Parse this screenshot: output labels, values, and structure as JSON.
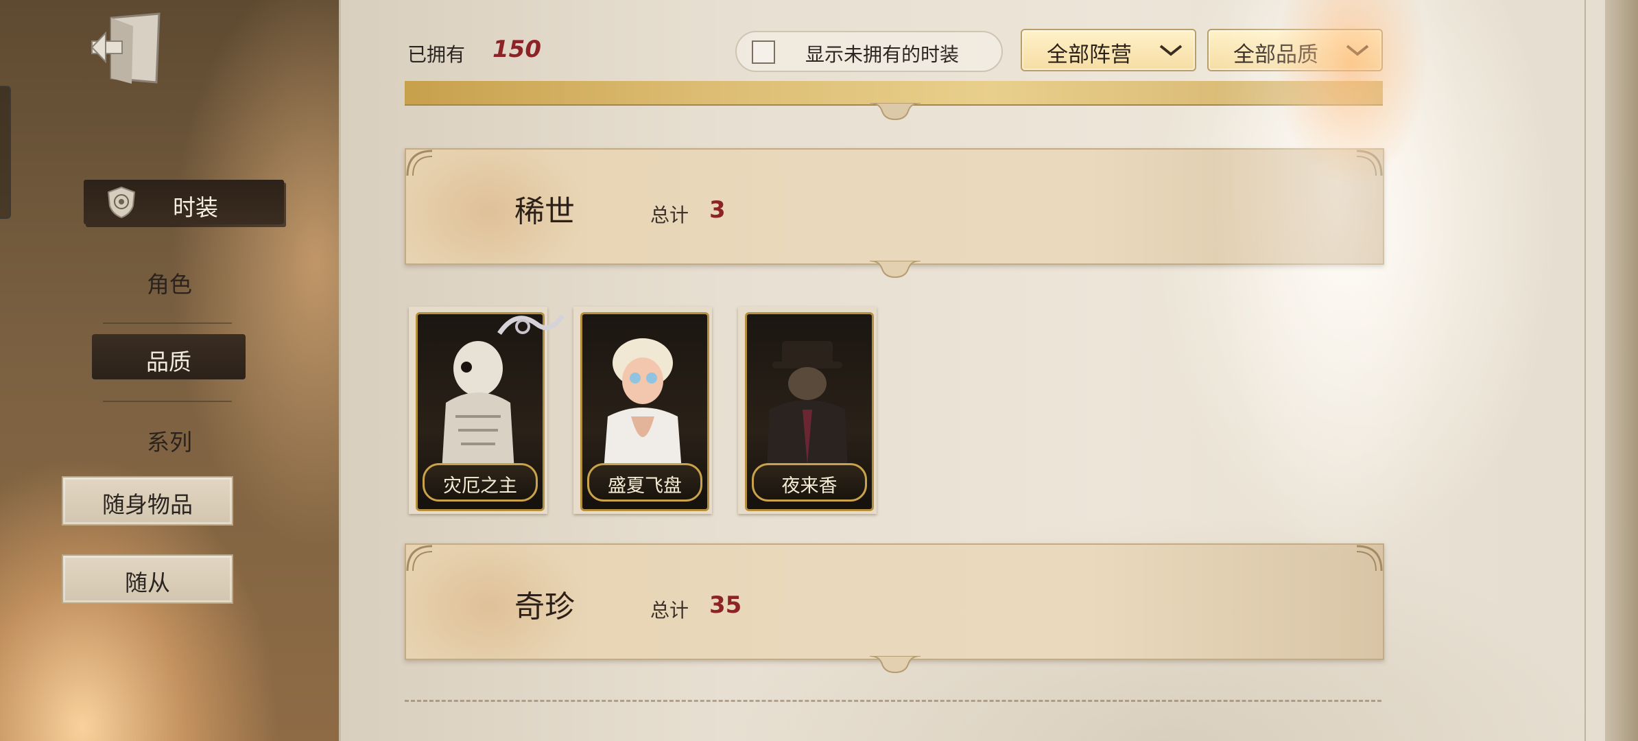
{
  "header": {
    "owned_label": "已拥有",
    "owned_count": "150",
    "toggle_label": "显示未拥有的时装",
    "filters": [
      {
        "label": "全部阵营"
      },
      {
        "label": "全部品质"
      }
    ]
  },
  "sidebar": {
    "selected": {
      "label": "时装",
      "icon": "shield-icon"
    },
    "items": [
      {
        "label": "角色"
      },
      {
        "label": "品质"
      },
      {
        "label": "系列"
      }
    ],
    "buttons": [
      {
        "label": "随身物品"
      },
      {
        "label": "随从"
      }
    ],
    "exit_icon": "exit-door-icon"
  },
  "sections": [
    {
      "title": "稀世",
      "total_label": "总计",
      "total": "3",
      "cards": [
        {
          "name": "灾厄之主"
        },
        {
          "name": "盛夏飞盘"
        },
        {
          "name": "夜来香"
        }
      ]
    },
    {
      "title": "奇珍",
      "total_label": "总计",
      "total": "35"
    }
  ],
  "colors": {
    "accent_red": "#8c2326",
    "gold": "#c9a24b",
    "paper": "#e7dfd1"
  }
}
